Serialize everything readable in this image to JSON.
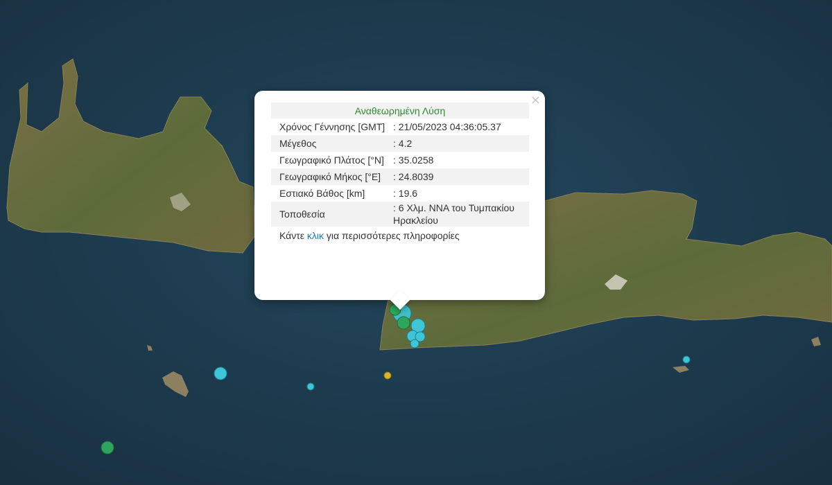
{
  "popup": {
    "title": "Αναθεωρημένη Λύση",
    "close_label": "×",
    "rows": [
      {
        "label": "Χρόνος Γέννησης [GMT]",
        "value": ": 21/05/2023 04:36:05.37"
      },
      {
        "label": "Μέγεθος",
        "value": ": 4.2"
      },
      {
        "label": "Γεωγραφικό Πλάτος [°N]",
        "value": ": 35.0258"
      },
      {
        "label": "Γεωγραφικό Μήκος [°E]",
        "value": ": 24.8039"
      },
      {
        "label": "Εστιακό Βάθος [km]",
        "value": ": 19.6"
      },
      {
        "label": "Τοποθεσία",
        "value": ": 6 Χλμ. ΝΝΑ του Τυμπακίου Ηρακλείου"
      }
    ],
    "more_prefix": "Κάντε ",
    "more_link": "κλικ",
    "more_suffix": " για περισσότερες πληροφορίες"
  },
  "colors": {
    "sea": "#1e3a4f",
    "land": "#6b6a3e",
    "marker_cyan": "#3ec6d8",
    "marker_green": "#2ea55a",
    "marker_yellow": "#d9b52a",
    "title_green": "#2e8b2e",
    "link_blue": "#1f77b4"
  }
}
